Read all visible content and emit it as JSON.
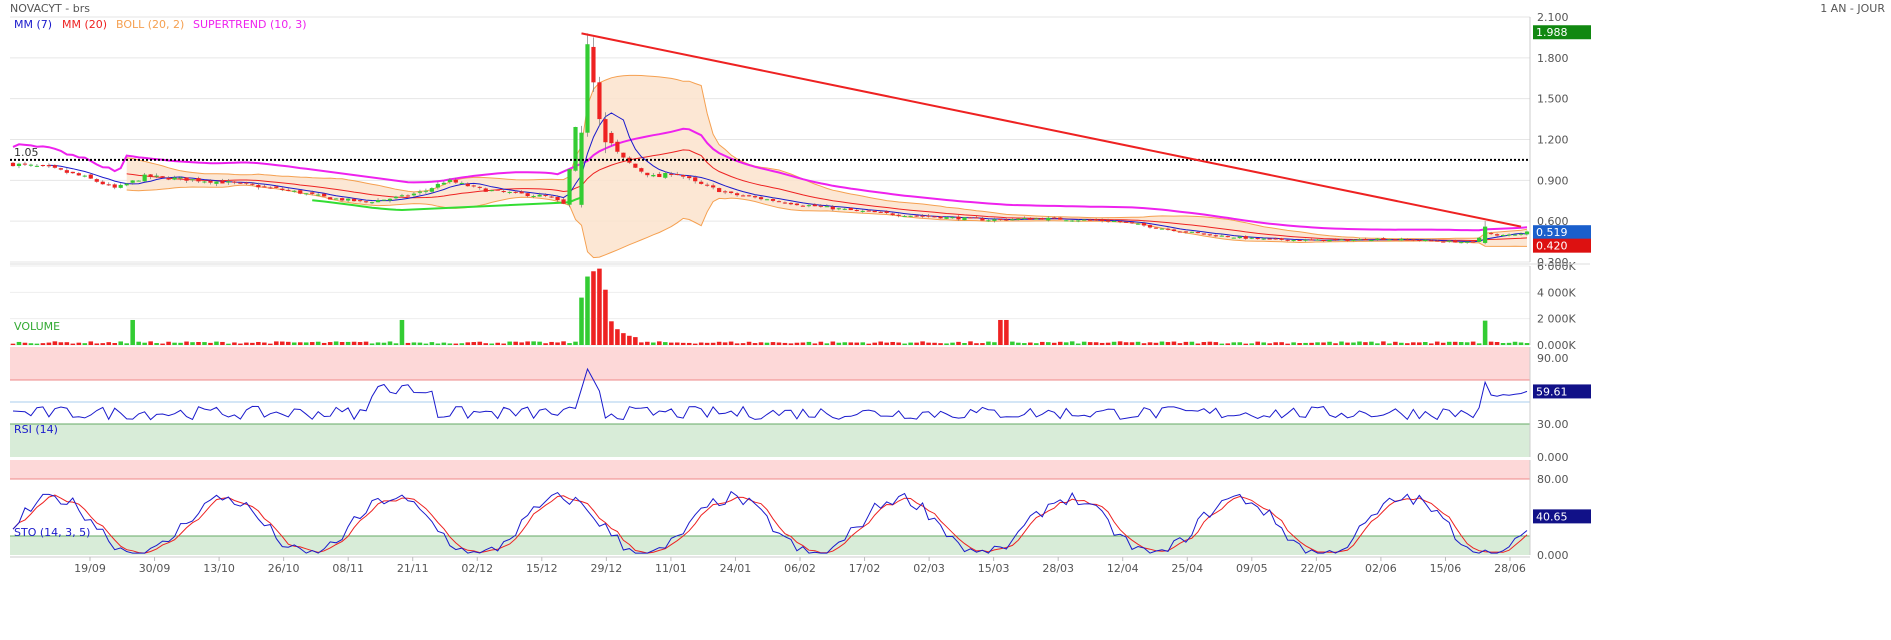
{
  "header": {
    "title": "NOVACYT - brs",
    "period": "1 AN - JOUR"
  },
  "colors": {
    "up": "#33cc33",
    "down": "#ee2222",
    "mm7": "#1a1acc",
    "mm20": "#ee2222",
    "boll": "#f5a050",
    "supertrend": "#ee22ee",
    "supertrend_up": "#33dd33",
    "trendline": "#ee2222",
    "rsi_line": "#1a1acc",
    "sto_k": "#1a1acc",
    "sto_d": "#ee2222"
  },
  "legend": [
    {
      "label": "MM (7)",
      "color": "#1a1acc"
    },
    {
      "label": "MM (20)",
      "color": "#ee2222"
    },
    {
      "label": "BOLL (20, 2)",
      "color": "#f5a050"
    },
    {
      "label": "SUPERTREND (10, 3)",
      "color": "#ee22ee"
    }
  ],
  "price_axis": {
    "ticks": [
      "2.100",
      "1.800",
      "1.500",
      "1.200",
      "0.900",
      "0.600",
      "0.300"
    ],
    "tick_values": [
      2.1,
      1.8,
      1.5,
      1.2,
      0.9,
      0.6,
      0.3
    ],
    "min": 0.3,
    "max": 2.1
  },
  "price_badges": [
    {
      "text": "1.988",
      "value": 1.988,
      "color": "#118811"
    },
    {
      "text": "0.519",
      "value": 0.519,
      "color": "#1a5fcc"
    },
    {
      "text": "0.420",
      "value": 0.42,
      "color": "#dd1111"
    }
  ],
  "level_line": {
    "label": "1.05",
    "value": 1.05
  },
  "trendline": {
    "from": {
      "i": 48,
      "v": 1.98
    },
    "to": {
      "i": 250,
      "v": 0.56
    }
  },
  "x_labels": [
    "19/09",
    "30/09",
    "13/10",
    "26/10",
    "08/11",
    "21/11",
    "02/12",
    "15/12",
    "29/12",
    "11/01",
    "24/01",
    "06/02",
    "17/02",
    "02/03",
    "15/03",
    "28/03",
    "12/04",
    "25/04",
    "09/05",
    "22/05",
    "02/06",
    "15/06",
    "28/06"
  ],
  "volume": {
    "title": "VOLUME",
    "ticks": [
      "6 000K",
      "4 000K",
      "2 000K",
      "0.000K"
    ],
    "tick_values": [
      6000,
      4000,
      2000,
      0
    ],
    "max": 6000
  },
  "rsi": {
    "title": "RSI (14)",
    "ticks": [
      "90.00",
      "60.00",
      "30.00",
      "0.000"
    ],
    "tick_values": [
      90,
      60,
      30,
      0
    ],
    "badge": "59.61",
    "badge_value": 59.61,
    "overbought": 70,
    "oversold": 30,
    "mid": 50
  },
  "sto": {
    "title": "STO (14, 3, 5)",
    "ticks": [
      "80.00",
      "40.00",
      "0.000"
    ],
    "tick_values": [
      80,
      40,
      0
    ],
    "badge": "40.65",
    "badge_value": 40.65,
    "overbought": 80,
    "oversold": 20
  },
  "chart_data": {
    "type": "candlestick",
    "title": "NOVACYT - brs",
    "subtitle": "1 AN - JOUR",
    "ylim": [
      0.3,
      2.1
    ],
    "key_points": [
      {
        "x": "19/09",
        "close": 1.0
      },
      {
        "x": "30/09",
        "close": 0.88
      },
      {
        "x": "13/10",
        "close": 0.93
      },
      {
        "x": "26/10",
        "close": 0.88
      },
      {
        "x": "08/11",
        "close": 0.84
      },
      {
        "x": "21/11",
        "close": 0.74
      },
      {
        "x": "02/12",
        "close": 0.8
      },
      {
        "x": "15/12",
        "close": 0.82
      },
      {
        "x": "29/12",
        "close": 1.95
      },
      {
        "x": "11/01",
        "close": 1.05
      },
      {
        "x": "24/01",
        "close": 0.93
      },
      {
        "x": "06/02",
        "close": 0.78
      },
      {
        "x": "17/02",
        "close": 0.72
      },
      {
        "x": "02/03",
        "close": 0.68
      },
      {
        "x": "15/03",
        "close": 0.63
      },
      {
        "x": "28/03",
        "close": 0.62
      },
      {
        "x": "12/04",
        "close": 0.62
      },
      {
        "x": "25/04",
        "close": 0.54
      },
      {
        "x": "09/05",
        "close": 0.48
      },
      {
        "x": "22/05",
        "close": 0.46
      },
      {
        "x": "02/06",
        "close": 0.47
      },
      {
        "x": "15/06",
        "close": 0.46
      },
      {
        "x": "28/06",
        "close": 0.519
      }
    ]
  }
}
